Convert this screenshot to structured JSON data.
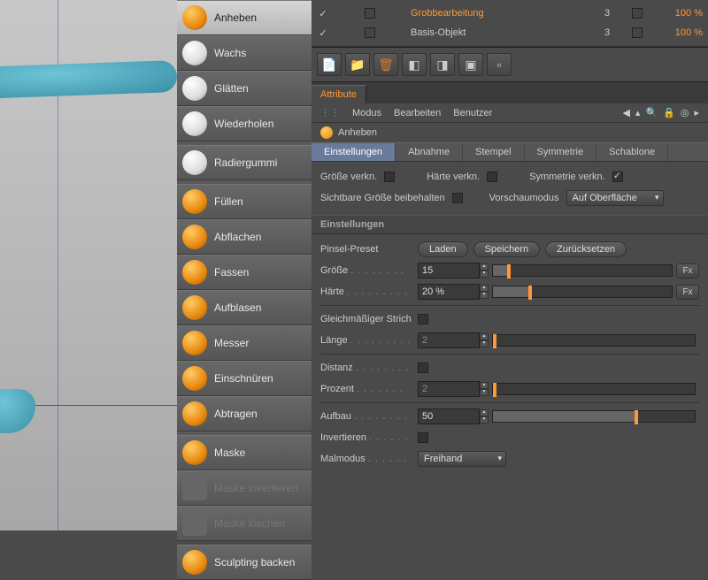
{
  "tools": {
    "g1": [
      "Anheben",
      "Wachs",
      "Glätten",
      "Wiederholen"
    ],
    "g2": [
      "Radiergummi"
    ],
    "g3": [
      "Füllen",
      "Abflachen",
      "Fassen",
      "Aufblasen",
      "Messer",
      "Einschnüren",
      "Abtragen"
    ],
    "g4": [
      "Maske",
      "Maske invertieren",
      "Maske löschen"
    ],
    "g5": [
      "Sculpting backen"
    ]
  },
  "layers": [
    {
      "name": "Grobbearbeitung",
      "hl": true,
      "num": "3",
      "pct": "100 %"
    },
    {
      "name": "Basis-Objekt",
      "hl": false,
      "num": "3",
      "pct": "100 %"
    }
  ],
  "attr_tab": "Attribute",
  "menu": {
    "modus": "Modus",
    "bearbeiten": "Bearbeiten",
    "benutzer": "Benutzer"
  },
  "tool_name": "Anheben",
  "subtabs": [
    "Einstellungen",
    "Abnahme",
    "Stempel",
    "Symmetrie",
    "Schablone"
  ],
  "row1": {
    "a": "Größe verkn.",
    "b": "Härte verkn.",
    "c": "Symmetrie verkn."
  },
  "row2": {
    "a": "Sichtbare Größe beibehalten",
    "b": "Vorschaumodus",
    "c": "Auf Oberfläche"
  },
  "section": "Einstellungen",
  "preset": {
    "label": "Pinsel-Preset",
    "laden": "Laden",
    "speichern": "Speichern",
    "zur": "Zurücksetzen"
  },
  "params": {
    "groesse": {
      "label": "Größe",
      "val": "15",
      "pct": 8
    },
    "haerte": {
      "label": "Härte",
      "val": "20 %",
      "pct": 20
    },
    "strich": "Gleichmäßiger Strich",
    "laenge": {
      "label": "Länge",
      "val": "2"
    },
    "distanz": "Distanz",
    "prozent": {
      "label": "Prozent",
      "val": "2"
    },
    "aufbau": {
      "label": "Aufbau",
      "val": "50",
      "pct": 70
    },
    "invert": "Invertieren",
    "malmodus": {
      "label": "Malmodus",
      "val": "Freihand"
    }
  },
  "fx": "Fx"
}
